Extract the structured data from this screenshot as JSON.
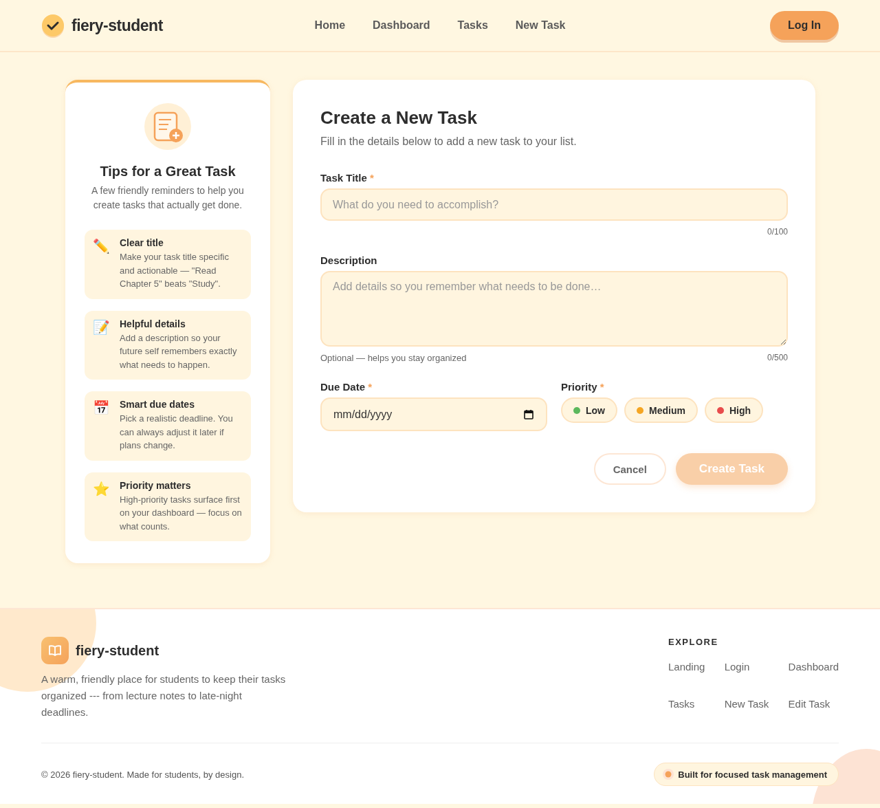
{
  "header": {
    "brand": "fiery-student",
    "nav": [
      {
        "label": "Home"
      },
      {
        "label": "Dashboard"
      },
      {
        "label": "Tasks"
      },
      {
        "label": "New Task"
      }
    ],
    "login": "Log In"
  },
  "tips": {
    "title": "Tips for a Great Task",
    "subtitle": "A few friendly reminders to help you create tasks that actually get done.",
    "items": [
      {
        "icon": "✏️",
        "title": "Clear title",
        "text": "Make your task title specific and actionable — \"Read Chapter 5\" beats \"Study\"."
      },
      {
        "icon": "📝",
        "title": "Helpful details",
        "text": "Add a description so your future self remembers exactly what needs to happen."
      },
      {
        "icon": "📅",
        "title": "Smart due dates",
        "text": "Pick a realistic deadline. You can always adjust it later if plans change."
      },
      {
        "icon": "⭐",
        "title": "Priority matters",
        "text": "High-priority tasks surface first on your dashboard — focus on what counts."
      }
    ]
  },
  "form": {
    "title": "Create a New Task",
    "subtitle": "Fill in the details below to add a new task to your list.",
    "task_title": {
      "label": "Task Title",
      "required": "*",
      "placeholder": "What do you need to accomplish?",
      "count": "0/100"
    },
    "description": {
      "label": "Description",
      "placeholder": "Add details so you remember what needs to be done…",
      "hint": "Optional — helps you stay organized",
      "count": "0/500"
    },
    "due_date": {
      "label": "Due Date",
      "required": "*",
      "placeholder": "mm/dd/yyyy"
    },
    "priority": {
      "label": "Priority",
      "required": "*",
      "options": [
        {
          "label": "Low",
          "color": "#5cb85c",
          "selected": false
        },
        {
          "label": "Medium",
          "color": "#f5a623",
          "selected": false
        },
        {
          "label": "High",
          "color": "#e84c4c",
          "selected": false
        }
      ]
    },
    "cancel": "Cancel",
    "submit": "Create Task",
    "submit_disabled": true
  },
  "footer": {
    "brand": "fiery-student",
    "about": "A warm, friendly place for students to keep their tasks organized --- from lecture notes to late-night deadlines.",
    "explore_title": "EXPLORE",
    "links": [
      {
        "label": "Landing"
      },
      {
        "label": "Login"
      },
      {
        "label": "Dashboard"
      },
      {
        "label": "Tasks"
      },
      {
        "label": "New Task"
      },
      {
        "label": "Edit Task"
      }
    ],
    "copyright": "© 2026 fiery-student. Made for students, by design.",
    "badge": "Built for focused task management"
  }
}
